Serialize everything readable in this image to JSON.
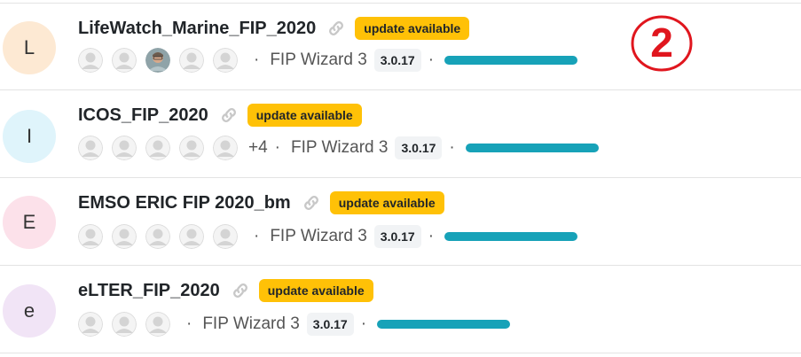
{
  "projects": [
    {
      "initial": "L",
      "avatar_color": "#fde9d3",
      "name": "LifeWatch_Marine_FIP_2020",
      "badge": "update available",
      "users": [
        "placeholder",
        "placeholder",
        "photo",
        "placeholder",
        "placeholder"
      ],
      "more_users": "",
      "template": "FIP Wizard 3",
      "version": "3.0.17",
      "progress": 1.0
    },
    {
      "initial": "I",
      "avatar_color": "#dff4fb",
      "name": "ICOS_FIP_2020",
      "badge": "update available",
      "users": [
        "placeholder",
        "placeholder",
        "placeholder",
        "placeholder",
        "placeholder"
      ],
      "more_users": "+4",
      "template": "FIP Wizard 3",
      "version": "3.0.17",
      "progress": 1.0
    },
    {
      "initial": "E",
      "avatar_color": "#fce1ea",
      "name": "EMSO ERIC FIP 2020_bm",
      "badge": "update available",
      "users": [
        "placeholder",
        "placeholder",
        "placeholder",
        "placeholder",
        "placeholder"
      ],
      "more_users": "",
      "template": "FIP Wizard 3",
      "version": "3.0.17",
      "progress": 1.0
    },
    {
      "initial": "e",
      "avatar_color": "#f1e4f6",
      "name": "eLTER_FIP_2020",
      "badge": "update available",
      "users": [
        "placeholder",
        "placeholder",
        "placeholder"
      ],
      "more_users": "",
      "template": "FIP Wizard 3",
      "version": "3.0.17",
      "progress": 1.0
    }
  ],
  "separator": "·",
  "annotation": {
    "label": "2",
    "color": "#e0161e"
  },
  "colors": {
    "badge": "#ffc107",
    "progress": "#17a2b8",
    "version_bg": "#f1f3f5",
    "placeholder_avatar": "#d4d4d4"
  }
}
